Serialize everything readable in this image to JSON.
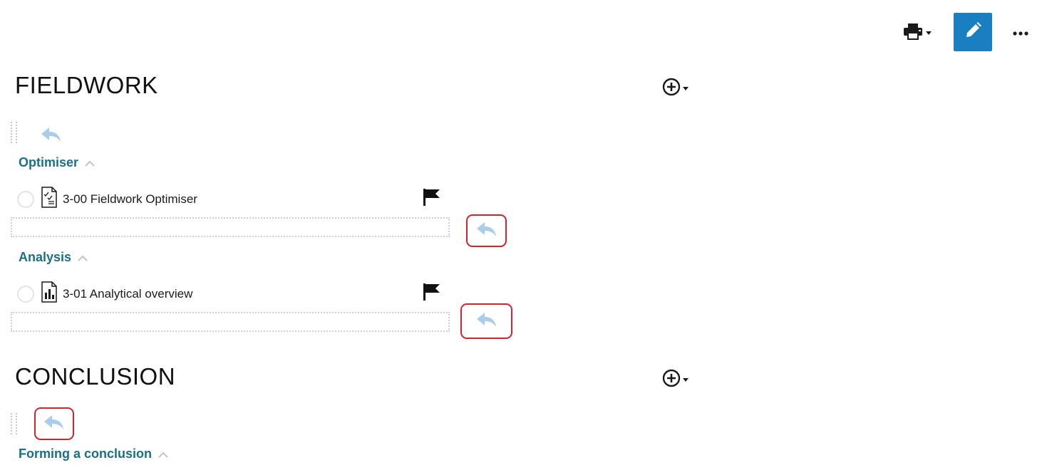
{
  "toolbar": {
    "print_icon": "printer-icon",
    "edit_icon": "pencil-icon",
    "more_icon": "ellipsis-icon",
    "edit_bg": "#1a7fc1"
  },
  "sections": [
    {
      "title": "FIELDWORK",
      "groups": [
        {
          "title": "Optimiser",
          "items": [
            {
              "label": "3-00 Fieldwork Optimiser",
              "icon": "checklist-doc-icon"
            }
          ]
        },
        {
          "title": "Analysis",
          "items": [
            {
              "label": "3-01 Analytical overview",
              "icon": "chart-doc-icon"
            }
          ]
        }
      ]
    },
    {
      "title": "CONCLUSION",
      "groups": [
        {
          "title": "Forming a conclusion",
          "items": []
        }
      ]
    }
  ],
  "colors": {
    "group_title": "#1b6f86",
    "reply_icon": "#a9cdea",
    "highlight": "#d3232b"
  }
}
